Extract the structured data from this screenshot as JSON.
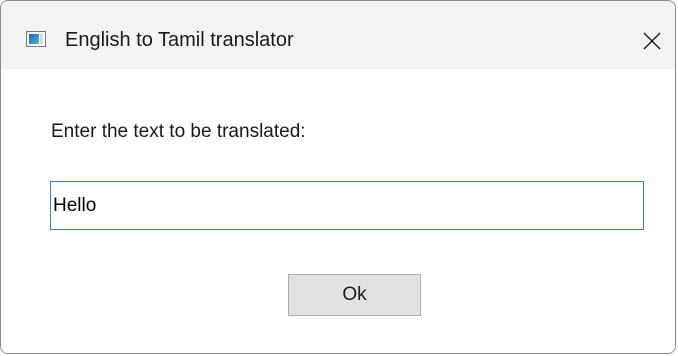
{
  "window": {
    "title": "English to Tamil translator",
    "icon": "app-window-icon",
    "close_icon": "close-icon"
  },
  "dialog": {
    "prompt_label": "Enter the text to be translated:",
    "input_value": "Hello",
    "ok_label": "Ok"
  },
  "colors": {
    "titlebar_bg": "#f3f3f3",
    "input_focus_border": "#3b78d8",
    "button_bg": "#e1e1e1",
    "button_border": "#adadad"
  }
}
